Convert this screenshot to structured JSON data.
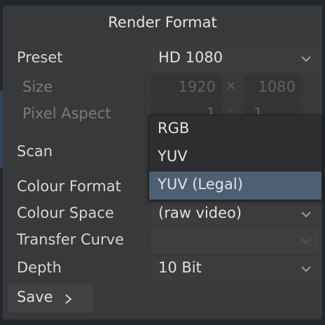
{
  "title": "Render Format",
  "rows": {
    "preset": {
      "label": "Preset",
      "value": "HD 1080"
    },
    "size": {
      "label": "Size",
      "width": "1920",
      "height": "1080",
      "separator": "×"
    },
    "pixel_aspect": {
      "label": "Pixel Aspect",
      "left": "1",
      "right": "1",
      "separator": ":"
    },
    "scan": {
      "label": "Scan"
    },
    "colour_format": {
      "label": "Colour Format"
    },
    "colour_space": {
      "label": "Colour Space",
      "value": "(raw video)"
    },
    "transfer_curve": {
      "label": "Transfer Curve",
      "value": ""
    },
    "depth": {
      "label": "Depth",
      "value": "10 Bit"
    }
  },
  "save": {
    "label": "Save",
    "icon": "chevron-right-icon"
  },
  "dropdown": {
    "options": [
      "RGB",
      "YUV",
      "YUV (Legal)"
    ],
    "selected": "YUV (Legal)"
  },
  "colors": {
    "background": "#38393b",
    "highlight": "#4f5f73",
    "accent_edge": "#2f4461"
  }
}
